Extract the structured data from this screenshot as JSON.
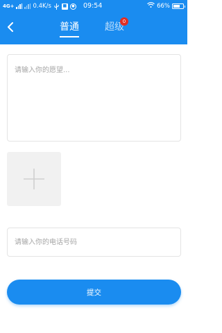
{
  "status_bar": {
    "network": "4G+",
    "speed": "0.4K/s",
    "time": "09:54",
    "battery": "66%",
    "battery_level": 0.66,
    "icons": [
      "signal-icon",
      "usb-icon",
      "notification-icon",
      "sync-icon",
      "wifi-icon",
      "battery-icon"
    ]
  },
  "header": {
    "back_icon": "chevron-left-icon",
    "tabs": [
      {
        "label": "普通",
        "active": true
      },
      {
        "label": "超级",
        "active": false,
        "badge": "0"
      }
    ]
  },
  "form": {
    "wish_placeholder": "请输入你的愿望...",
    "add_photo_icon": "plus-icon",
    "phone_placeholder": "请输入你的电话号码",
    "submit_label": "提交"
  },
  "colors": {
    "primary": "#1a8cf0",
    "badge": "#e02e24",
    "placeholder": "#a6a6a6"
  }
}
